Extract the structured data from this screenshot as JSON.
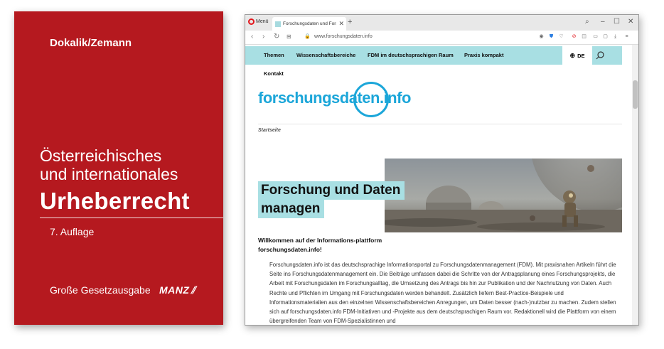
{
  "book": {
    "authors": "Dokalik/Zemann",
    "title_line1": "Österreichisches",
    "title_line2": "und internationales",
    "title_line3": "Urheberrecht",
    "edition": "7. Auflage",
    "series": "Große Gesetzausgabe",
    "publisher": "MANZ",
    "color": "#b5191f"
  },
  "browser": {
    "menu_label": "Menü",
    "tab_title": "Forschungsdaten und Forsc",
    "url": "www.forschungsdaten.info",
    "accent": "#a8dfe3"
  },
  "site": {
    "nav": [
      "Themen",
      "Wissenschaftsbereiche",
      "FDM im deutschsprachigen Raum",
      "Praxis kompakt"
    ],
    "lang": "DE",
    "kontakt": "Kontakt",
    "logo_text": "forschungsdaten.info",
    "breadcrumb": "Startseite",
    "hero_line1": "Forschung und Daten",
    "hero_line2": "managen",
    "welcome": "Willkommen auf der Informations-plattform forschungsdaten.info!",
    "body": "Forschungsdaten.info ist das deutschsprachige Informationsportal zu Forschungsdatenmanagement (FDM). Mit praxisnahen Artikeln führt die Seite ins Forschungsdatenmanagement ein. Die Beiträge umfassen dabei die Schritte von der Antragsplanung eines Forschungsprojekts, die Arbeit mit Forschungsdaten im Forschungsalltag, die Umsetzung des Antrags bis hin zur Publikation und der Nachnutzung von Daten. Auch Rechte und Pflichten im Umgang mit Forschungsdaten werden behandelt. Zusätzlich liefern Best-Practice-Beispiele und Informationsmaterialien aus den einzelnen Wissenschaftsbereichen Anregungen, um Daten besser (nach-)nutzbar zu machen. Zudem stellen sich auf forschungsdaten.info FDM-Initiativen und -Projekte aus dem deutschsprachigen Raum vor. Redaktionell wird die Plattform von einem übergreifenden Team von FDM-Spezialistinnen und",
    "brand_color": "#1ba6d9"
  }
}
